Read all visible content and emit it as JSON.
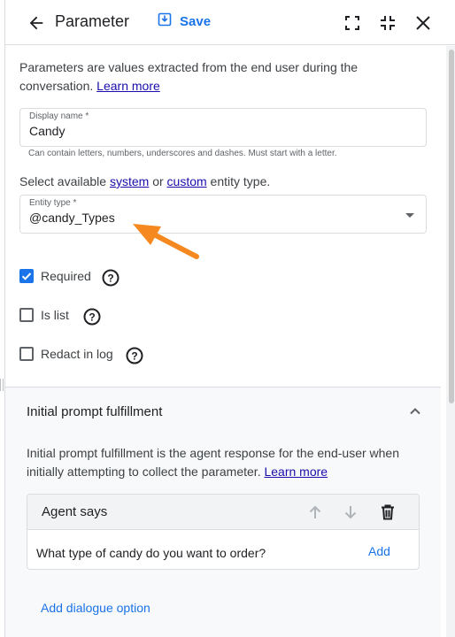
{
  "header": {
    "title": "Parameter",
    "save_label": "Save"
  },
  "intro": {
    "text": "Parameters are values extracted from the end user during the conversation.",
    "learn_more": "Learn more"
  },
  "display_name": {
    "label": "Display name *",
    "value": "Candy",
    "hint": "Can contain letters, numbers, underscores and dashes. Must start with a letter."
  },
  "entity_select": {
    "prefix": "Select available",
    "system_link": "system",
    "middle": "or",
    "custom_link": "custom",
    "suffix": "entity type."
  },
  "entity_type": {
    "label": "Entity type *",
    "value": "@candy_Types"
  },
  "options": {
    "required": {
      "label": "Required",
      "checked": true
    },
    "is_list": {
      "label": "Is list",
      "checked": false
    },
    "redact": {
      "label": "Redact in log",
      "checked": false
    }
  },
  "initial_prompt": {
    "title": "Initial prompt fulfillment",
    "description": "Initial prompt fulfillment is the agent response for the end-user when initially attempting to collect the parameter.",
    "learn_more": "Learn more",
    "card_title": "Agent says",
    "response_text": "What type of candy do you want to order?",
    "add_label": "Add",
    "add_dialogue": "Add dialogue option"
  },
  "colors": {
    "accent": "#1a73e8",
    "annotation_arrow": "#f5891f",
    "link": "#1a0dab"
  }
}
